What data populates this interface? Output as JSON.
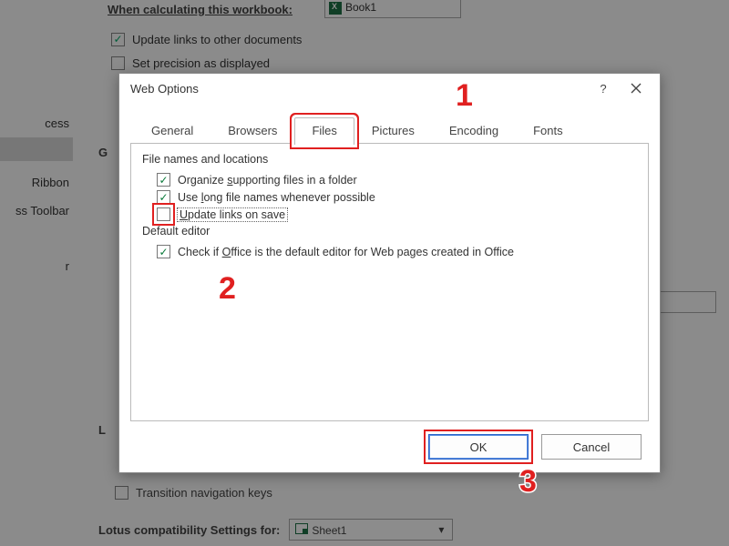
{
  "background": {
    "when_calc_label": "When calculating this workbook:",
    "workbook_combo": "Book1",
    "update_links": "Update links to other documents",
    "set_precision": "Set precision as displayed",
    "sidebar": {
      "cess": "cess",
      "ribbon": "Ribbon",
      "qat": "ss Toolbar",
      "r": "r"
    },
    "group_g": "G",
    "group_l": "L",
    "transition_nav": "Transition navigation keys",
    "lotus_label": "Lotus compatibility Settings for:",
    "sheet_combo": "Sheet1"
  },
  "dialog": {
    "title": "Web Options",
    "help": "?",
    "tabs": {
      "general": "General",
      "browsers": "Browsers",
      "files": "Files",
      "pictures": "Pictures",
      "encoding": "Encoding",
      "fonts": "Fonts"
    },
    "files_pane": {
      "section1": "File names and locations",
      "organize": {
        "pre": "Organize ",
        "u": "s",
        "post": "upporting files in a folder",
        "checked": true
      },
      "longnames": {
        "pre": "Use ",
        "u": "l",
        "post": "ong file names whenever possible",
        "checked": true
      },
      "updatelinks": {
        "u": "U",
        "post": "pdate links on save",
        "checked": false
      },
      "section2": "Default editor",
      "defaulteditor": {
        "pre": "Check if ",
        "u": "O",
        "post": "ffice is the default editor for Web pages created in Office",
        "checked": true
      }
    },
    "buttons": {
      "ok": "OK",
      "cancel": "Cancel"
    }
  },
  "annotations": {
    "n1": "1",
    "n2": "2",
    "n3": "3"
  }
}
